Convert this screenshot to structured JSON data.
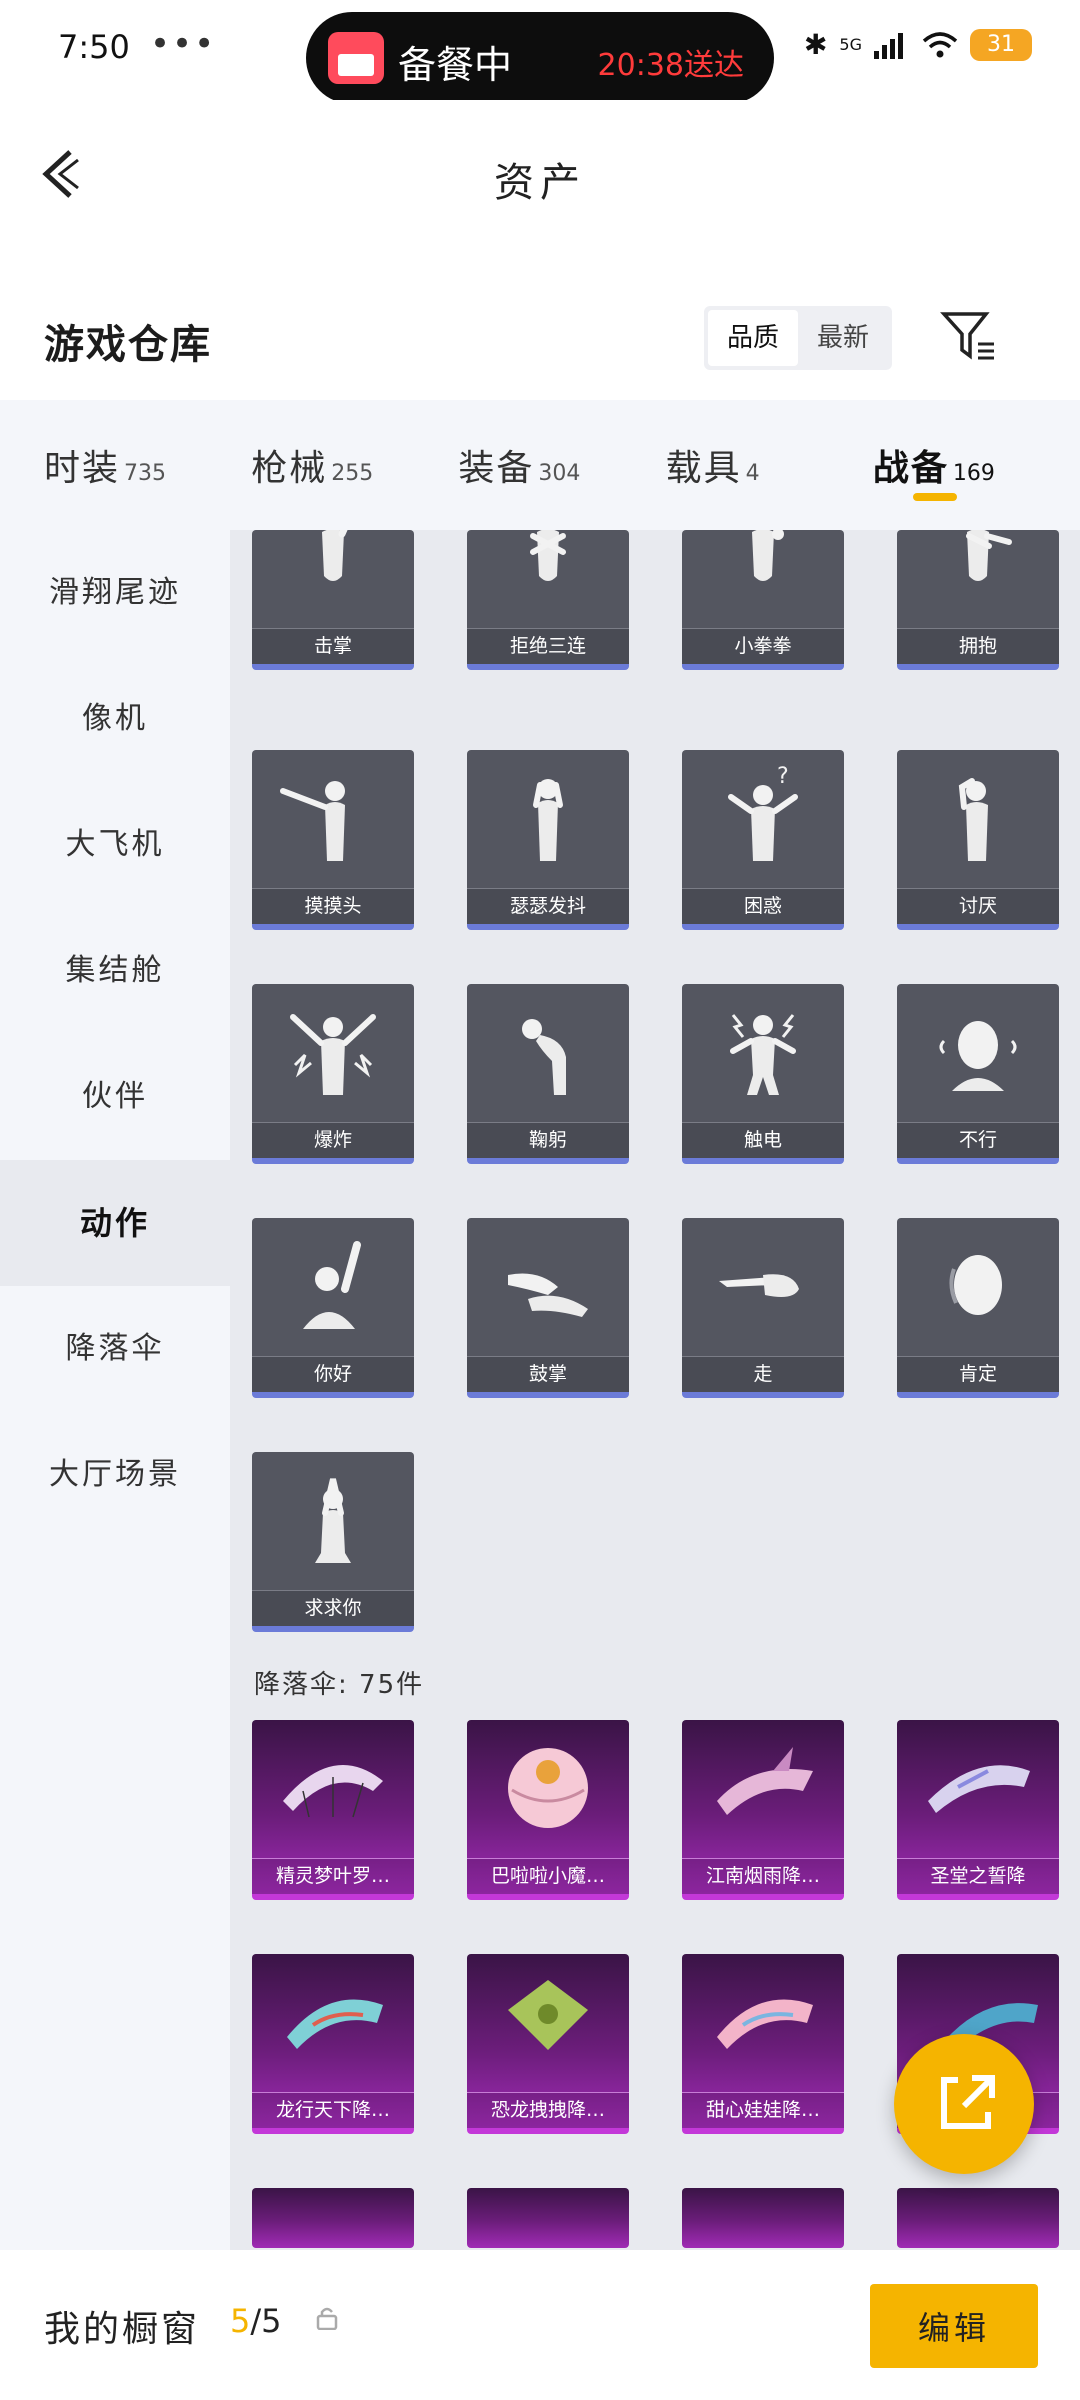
{
  "status_bar": {
    "time": "7:50",
    "dots": "•••",
    "island_status": "备餐中",
    "island_time": "20:38送达",
    "network": "5G",
    "battery": "31"
  },
  "header": {
    "title": "资产",
    "back_icon": "chevron-left-icon"
  },
  "section": {
    "title": "游戏仓库",
    "sort_options": [
      "品质",
      "最新"
    ],
    "sort_selected": "品质",
    "filter_icon": "filter-icon"
  },
  "tabs": [
    {
      "label": "时装",
      "count": "735"
    },
    {
      "label": "枪械",
      "count": "255"
    },
    {
      "label": "装备",
      "count": "304"
    },
    {
      "label": "载具",
      "count": "4"
    },
    {
      "label": "战备",
      "count": "169",
      "active": true
    }
  ],
  "sidebar": {
    "items": [
      {
        "label": "滑翔尾迹"
      },
      {
        "label": "像机"
      },
      {
        "label": "大飞机"
      },
      {
        "label": "集结舱"
      },
      {
        "label": "伙伴"
      },
      {
        "label": "动作",
        "active": true
      },
      {
        "label": "降落伞"
      },
      {
        "label": "大厅场景"
      }
    ]
  },
  "emotes": [
    "击掌",
    "拒绝三连",
    "小拳拳",
    "拥抱",
    "摸摸头",
    "瑟瑟发抖",
    "困惑",
    "讨厌",
    "爆炸",
    "鞠躬",
    "触电",
    "不行",
    "你好",
    "鼓掌",
    "走",
    "肯定",
    "求求你"
  ],
  "parachute_section": {
    "label": "降落伞: 75件"
  },
  "parachutes": [
    "精灵梦叶罗…",
    "巴啦啦小魔…",
    "江南烟雨降…",
    "圣堂之誓降",
    "龙行天下降…",
    "恐龙拽拽降…",
    "甜心娃娃降…",
    ""
  ],
  "colors": {
    "accent": "#f5b400",
    "emote_bar": "#6b7bd8",
    "chute_purple": "#a02bb5"
  },
  "bottom_bar": {
    "title": "我的橱窗",
    "current": "5",
    "total": "/5",
    "lock_icon": "lock-icon",
    "edit_label": "编辑"
  },
  "fab": {
    "icon": "share-external-icon"
  }
}
